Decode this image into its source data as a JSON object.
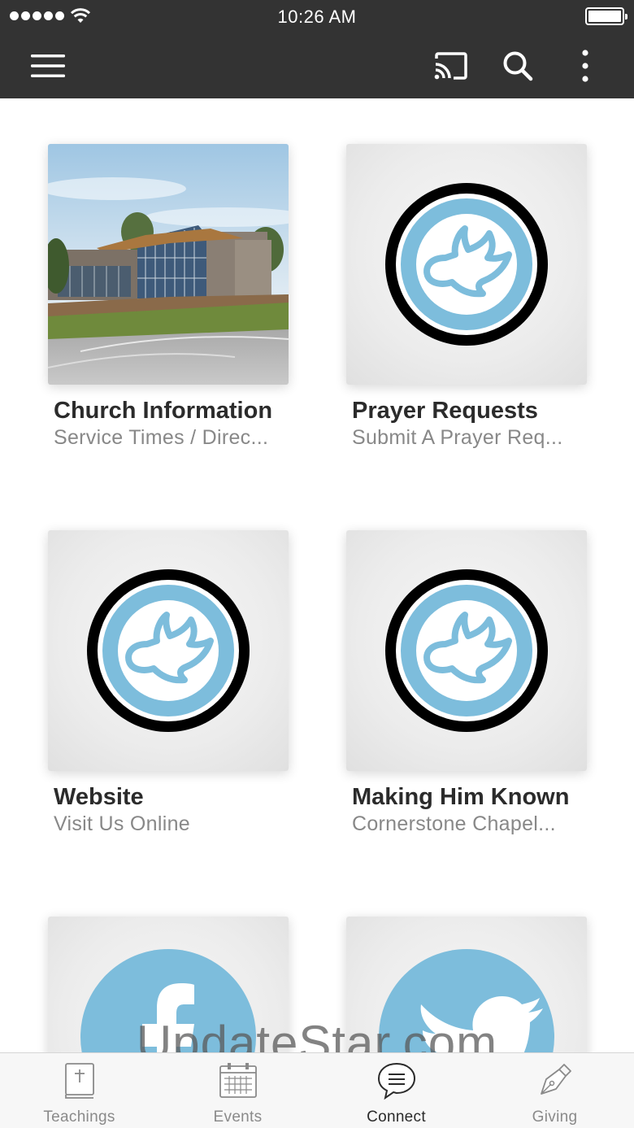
{
  "status_bar": {
    "time": "10:26 AM"
  },
  "nav": {
    "icons": [
      "menu-icon",
      "cast-icon",
      "search-icon",
      "more-vertical-icon"
    ]
  },
  "tiles": [
    {
      "title": "Church Information",
      "subtitle": "Service Times / Direc...",
      "image": "church-building-image"
    },
    {
      "title": "Prayer Requests",
      "subtitle": "Submit A Prayer Req...",
      "image": "dove-logo-icon"
    },
    {
      "title": "Website",
      "subtitle": "Visit Us Online",
      "image": "dove-logo-icon"
    },
    {
      "title": "Making Him Known",
      "subtitle": "Cornerstone Chapel...",
      "image": "dove-logo-icon"
    },
    {
      "title": "",
      "subtitle": "",
      "image": "facebook-icon"
    },
    {
      "title": "",
      "subtitle": "",
      "image": "twitter-icon"
    }
  ],
  "watermark": "UpdateStar.com",
  "tabs": [
    {
      "label": "Teachings",
      "icon": "bible-icon",
      "active": false
    },
    {
      "label": "Events",
      "icon": "calendar-icon",
      "active": false
    },
    {
      "label": "Connect",
      "icon": "chat-bubble-icon",
      "active": true
    },
    {
      "label": "Giving",
      "icon": "pen-icon",
      "active": false
    }
  ],
  "colors": {
    "bar": "#333333",
    "logo_blue": "#7dbddc",
    "logo_ring": "#000000",
    "tab_active": "#2b2b2b",
    "tab_inactive": "#8a8a8a"
  }
}
